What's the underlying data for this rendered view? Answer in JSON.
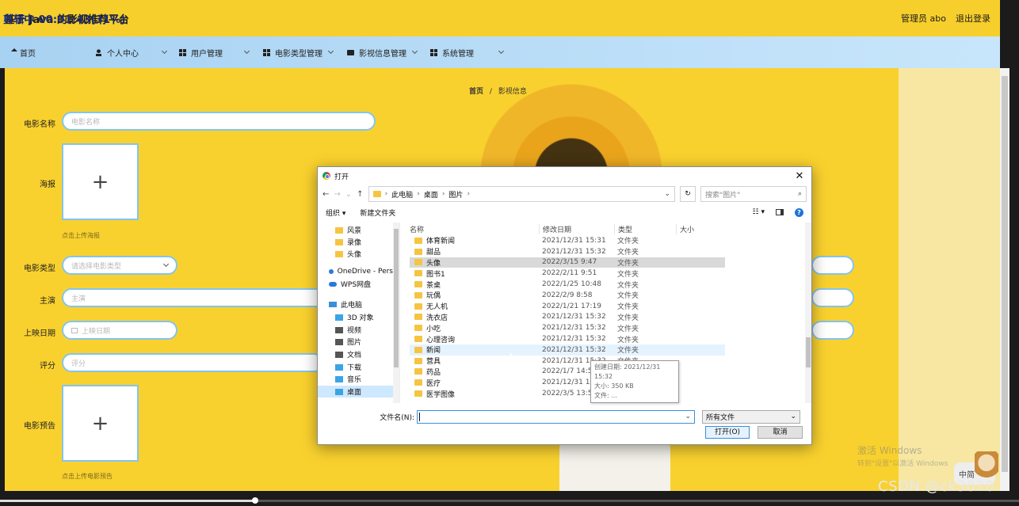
{
  "header": {
    "title": "基于 Java 的影视推荐平台",
    "user_label": "管理员 abo",
    "logout_label": "退出登录"
  },
  "overlay": {
    "video_time": "剪辑中 00:01:43(31%)",
    "csdn_watermark": "CSDN @ck3020",
    "win_activate_title": "激活 Windows",
    "win_activate_sub": "转到\"设置\"以激活 Windows",
    "ime_label": "中简"
  },
  "nav": {
    "items": [
      {
        "label": "首页"
      },
      {
        "label": "个人中心"
      },
      {
        "label": "用户管理"
      },
      {
        "label": "电影类型管理"
      },
      {
        "label": "影视信息管理"
      },
      {
        "label": "系统管理"
      }
    ]
  },
  "breadcrumb": {
    "home": "首页",
    "sep": "/",
    "current": "影视信息"
  },
  "form": {
    "movie_name_label": "电影名称",
    "movie_name_placeholder": "电影名称",
    "poster_label": "海报",
    "poster_plus": "+",
    "poster_hint": "点击上传海报",
    "type_label": "电影类型",
    "type_placeholder": "请选择电影类型",
    "actor_label": "主演",
    "actor_placeholder": "主演",
    "date_label": "上映日期",
    "date_placeholder": "上映日期",
    "score_label": "评分",
    "score_placeholder": "评分",
    "trailer_label": "电影预告",
    "trailer_plus": "+",
    "trailer_hint": "点击上传电影预告"
  },
  "dialog": {
    "title": "打开",
    "close": "✕",
    "path": [
      "此电脑",
      "桌面",
      "图片"
    ],
    "search_placeholder": "搜索\"图片\"",
    "organize_label": "组织 ▾",
    "new_folder_label": "新建文件夹",
    "tree": [
      {
        "label": "风景",
        "icon": "folder",
        "indent": 1
      },
      {
        "label": "录像",
        "icon": "folder",
        "indent": 1
      },
      {
        "label": "头像",
        "icon": "folder",
        "indent": 1
      },
      {
        "label": "OneDrive - Pers",
        "icon": "cloud",
        "indent": 0
      },
      {
        "label": "WPS网盘",
        "icon": "cloud",
        "indent": 0
      },
      {
        "label": "此电脑",
        "icon": "pc",
        "indent": 0
      },
      {
        "label": "3D 对象",
        "icon": "blue",
        "indent": 1
      },
      {
        "label": "视频",
        "icon": "dark",
        "indent": 1
      },
      {
        "label": "图片",
        "icon": "dark",
        "indent": 1
      },
      {
        "label": "文档",
        "icon": "dark",
        "indent": 1
      },
      {
        "label": "下载",
        "icon": "blue",
        "indent": 1
      },
      {
        "label": "音乐",
        "icon": "blue",
        "indent": 1
      },
      {
        "label": "桌面",
        "icon": "blue",
        "indent": 1
      }
    ],
    "columns": {
      "name": "名称",
      "date": "修改日期",
      "type": "类型",
      "size": "大小"
    },
    "files": [
      {
        "name": "体育新闻",
        "date": "2021/12/31 15:31",
        "type": "文件夹"
      },
      {
        "name": "甜品",
        "date": "2021/12/31 15:32",
        "type": "文件夹"
      },
      {
        "name": "头像",
        "date": "2022/3/15 9:47",
        "type": "文件夹"
      },
      {
        "name": "图书1",
        "date": "2022/2/11 9:51",
        "type": "文件夹"
      },
      {
        "name": "茶桌",
        "date": "2022/1/25 10:48",
        "type": "文件夹"
      },
      {
        "name": "玩偶",
        "date": "2022/2/9 8:58",
        "type": "文件夹"
      },
      {
        "name": "无人机",
        "date": "2022/1/21 17:19",
        "type": "文件夹"
      },
      {
        "name": "洗衣店",
        "date": "2021/12/31 15:32",
        "type": "文件夹"
      },
      {
        "name": "小吃",
        "date": "2021/12/31 15:32",
        "type": "文件夹"
      },
      {
        "name": "心理咨询",
        "date": "2021/12/31 15:32",
        "type": "文件夹"
      },
      {
        "name": "新闻",
        "date": "2021/12/31 15:32",
        "type": "文件夹"
      },
      {
        "name": "营具",
        "date": "2021/12/31 15:32",
        "type": "文件夹"
      },
      {
        "name": "药品",
        "date": "2022/1/7 14:51",
        "type": "文件夹"
      },
      {
        "name": "医疗",
        "date": "2021/12/31 15:31",
        "type": "文件夹"
      },
      {
        "name": "医学图像",
        "date": "2022/3/5 13:55",
        "type": "文件夹"
      }
    ],
    "tooltip": {
      "created": "创建日期: 2021/12/31 15:32",
      "size": "大小: 350 KB",
      "files": "文件: ..."
    },
    "filename_label": "文件名(N):",
    "filename_value": "",
    "filetype_value": "所有文件",
    "open_label": "打开(O)",
    "cancel_label": "取消"
  }
}
